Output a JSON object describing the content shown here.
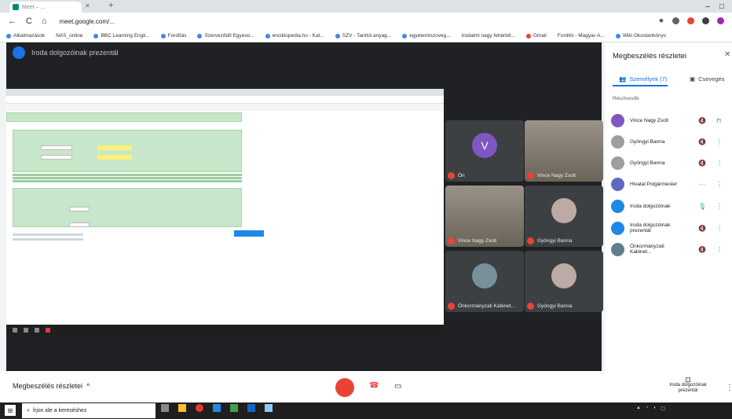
{
  "browser": {
    "tab_title": "Meet – ...",
    "tab_close": "✕",
    "new_tab": "+",
    "url": "meet.google.com/...",
    "window_controls": [
      "–",
      "□"
    ],
    "nav": {
      "back": "←",
      "forward": "→",
      "reload": "C",
      "home": "⌂"
    },
    "bookmarks": [
      "Alkalmazások",
      "NAS_online",
      "BBC Learning Engli...",
      "Fordítás",
      "Szerveződő Egyesü...",
      "enciklopedia.hu - Kat...",
      "SZV - Tanítói anyag...",
      "egyetemiszoveg...",
      "Irodalmi nagy fehérbő...",
      "Gmail",
      "Fordító - Magyar-A...",
      "Wiki Okostankönyv"
    ]
  },
  "meet": {
    "presenter_name": "Iroda dolgozóinak prezentál",
    "tiles": [
      {
        "name": "Ön",
        "letter": "V"
      },
      {
        "name": "Vince Nagy Zsolt"
      },
      {
        "name": "Vince Nagy Zsolt"
      },
      {
        "name": "Gyöngyi Banna"
      },
      {
        "name": "Önkormányzati Kabinet..."
      },
      {
        "name": "Gyöngyi Banna"
      }
    ],
    "panel": {
      "title": "Megbeszélés részletei",
      "close": "✕",
      "tab_people": "Személyek (7)",
      "tab_chat": "Csevegés",
      "section": "Résztvevők",
      "people": [
        {
          "name": "Vince Nagy Zsolt",
          "color": "#7e57c2",
          "mic": "🔇",
          "more": "⋮"
        },
        {
          "name": "Gyöngyi Banna",
          "color": "#9e9e9e",
          "mic": "🔇",
          "more": "⋮"
        },
        {
          "name": "Gyöngyi Banna",
          "color": "#9e9e9e",
          "mic": "🔇",
          "more": "⋮"
        },
        {
          "name": "Hivatal Polgármester",
          "color": "#5c6bc0",
          "mic": "···",
          "more": "⋮"
        },
        {
          "name": "Iroda dolgozóinak",
          "color": "#1e88e5",
          "mic": "🎙",
          "more": "⋮"
        },
        {
          "name": "Iroda dolgozóinak prezentál",
          "color": "#1e88e5",
          "mic": "🔇",
          "more": "⋮"
        },
        {
          "name": "Önkormányzati Kabinet...",
          "color": "#607d8b",
          "mic": "🔇",
          "more": "⋮"
        }
      ]
    },
    "bottom": {
      "details": "Megbeszélés részletei",
      "present_label": "Iroda dolgozóinak prezentál"
    }
  },
  "taskbar": {
    "search_placeholder": "Írjon ide a kereséshez"
  }
}
